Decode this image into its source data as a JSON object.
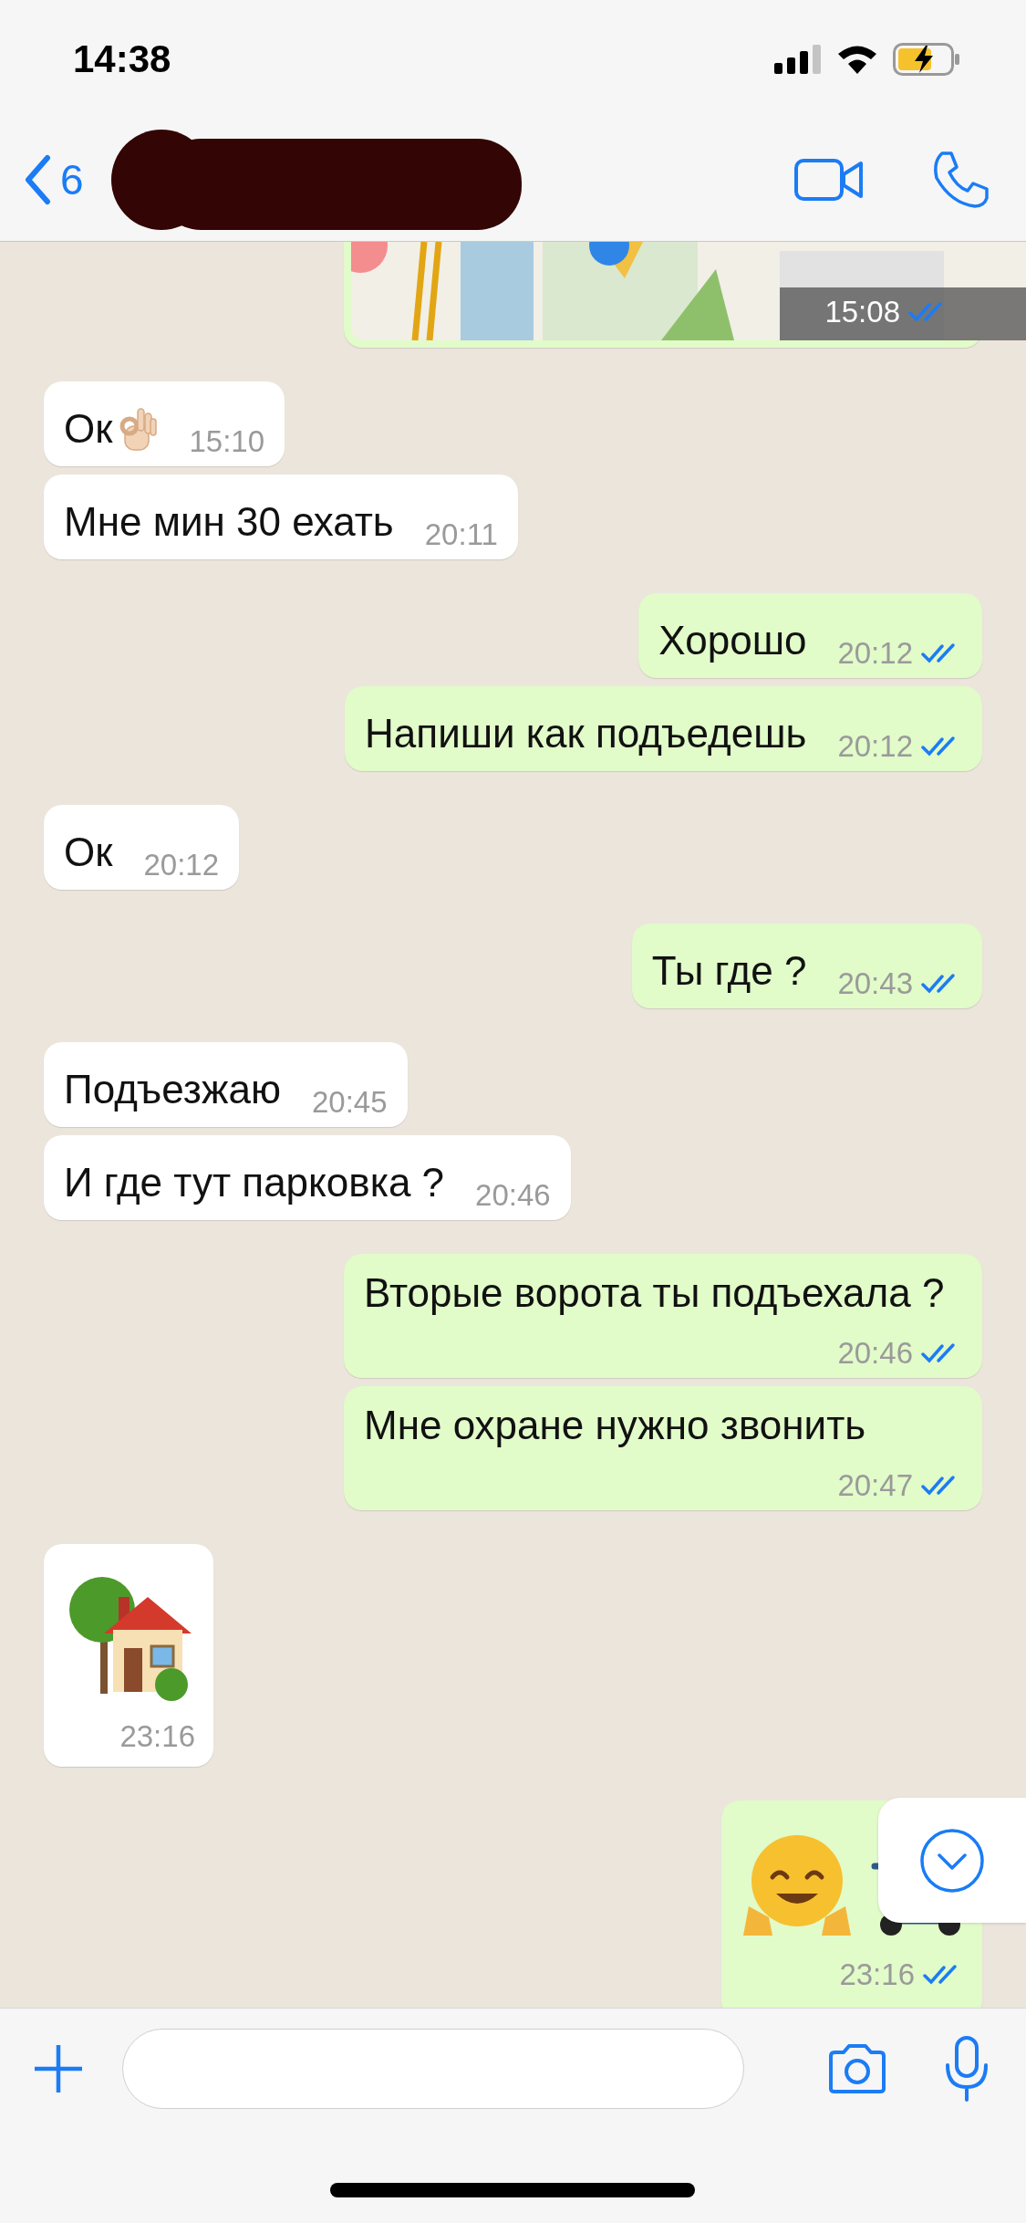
{
  "status_bar": {
    "time": "14:38"
  },
  "header": {
    "back_count": "6"
  },
  "messages": [
    {
      "outgoing": true,
      "kind": "map",
      "time": "15:08",
      "read": true
    },
    {
      "outgoing": false,
      "kind": "textemoji",
      "text": "Ок",
      "time": "15:10"
    },
    {
      "outgoing": false,
      "kind": "text",
      "text": "Мне мин 30 ехать",
      "time": "20:11"
    },
    {
      "outgoing": true,
      "kind": "text",
      "text": "Хорошо",
      "time": "20:12",
      "read": true
    },
    {
      "outgoing": true,
      "kind": "text",
      "text": "Напиши как подъедешь",
      "time": "20:12",
      "read": true
    },
    {
      "outgoing": false,
      "kind": "text",
      "text": "Ок",
      "time": "20:12"
    },
    {
      "outgoing": true,
      "kind": "text",
      "text": "Ты где ?",
      "time": "20:43",
      "read": true
    },
    {
      "outgoing": false,
      "kind": "text",
      "text": "Подъезжаю",
      "time": "20:45"
    },
    {
      "outgoing": false,
      "kind": "text",
      "text": "И где тут парковка ?",
      "time": "20:46"
    },
    {
      "outgoing": true,
      "kind": "text",
      "text": "Вторые ворота ты подъехала ?",
      "time": "20:46",
      "read": true
    },
    {
      "outgoing": true,
      "kind": "text",
      "text": "Мне охране нужно звонить",
      "time": "20:47",
      "read": true
    },
    {
      "outgoing": false,
      "kind": "house",
      "time": "23:16"
    },
    {
      "outgoing": true,
      "kind": "hugscooter",
      "time": "23:16",
      "read": true
    }
  ]
}
